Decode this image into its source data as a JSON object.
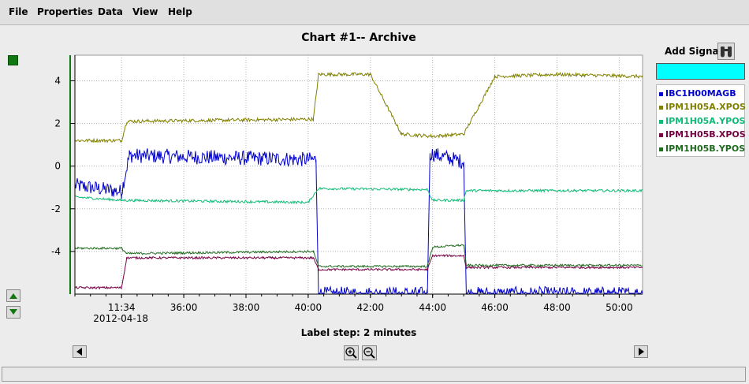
{
  "menu": [
    "File",
    "Properties",
    "Data",
    "View",
    "Help"
  ],
  "chart": {
    "title": "Chart #1-- Archive",
    "label_step": "Label step: 2 minutes"
  },
  "add_signal": {
    "label": "Add Signal",
    "input_value": ""
  },
  "legend": [
    {
      "name": "IBC1H00MAGB",
      "color": "#0000cc"
    },
    {
      "name": "IPM1H05A.XPOS",
      "color": "#808000"
    },
    {
      "name": "IPM1H05A.YPOS",
      "color": "#11bb77"
    },
    {
      "name": "IPM1H05B.XPOS",
      "color": "#770044"
    },
    {
      "name": "IPM1H05B.YPOS",
      "color": "#1f6b1f"
    }
  ],
  "chart_data": {
    "type": "line",
    "title": "Chart #1-- Archive",
    "xlabel": "Label step: 2 minutes",
    "ylabel": "",
    "x_unit": "minutes",
    "xlim": [
      "11:32:30",
      "11:50:45"
    ],
    "ylim": [
      -6.0,
      5.2
    ],
    "grid": true,
    "legend_position": "right",
    "x_ticks": [
      "11:34:00",
      "36:00",
      "38:00",
      "40:00",
      "42:00",
      "44:00",
      "46:00",
      "48:00",
      "50:00"
    ],
    "x_date_label": "2012-04-18",
    "y_ticks": [
      4,
      2,
      0,
      -2,
      -4
    ],
    "series": [
      {
        "name": "IBC1H00MAGB",
        "color": "#0000cc",
        "noise": 0.35,
        "points": [
          [
            "11:32:30",
            -0.9
          ],
          [
            "11:34:00",
            -1.2
          ],
          [
            "11:34:15",
            0.5
          ],
          [
            "11:40:15",
            0.3
          ],
          [
            "11:40:20",
            -6.0
          ],
          [
            "11:43:50",
            -6.0
          ],
          [
            "11:43:55",
            0.6
          ],
          [
            "11:45:00",
            0.2
          ],
          [
            "11:45:05",
            -6.0
          ],
          [
            "11:50:45",
            -6.0
          ]
        ]
      },
      {
        "name": "IPM1H05A.XPOS",
        "color": "#808000",
        "noise": 0.08,
        "points": [
          [
            "11:32:30",
            1.2
          ],
          [
            "11:34:00",
            1.2
          ],
          [
            "11:34:10",
            2.1
          ],
          [
            "11:40:10",
            2.2
          ],
          [
            "11:40:20",
            4.3
          ],
          [
            "11:42:00",
            4.3
          ],
          [
            "11:43:00",
            1.5
          ],
          [
            "11:44:00",
            1.4
          ],
          [
            "11:45:00",
            1.5
          ],
          [
            "11:46:00",
            4.2
          ],
          [
            "11:48:00",
            4.3
          ],
          [
            "11:50:45",
            4.2
          ]
        ]
      },
      {
        "name": "IPM1H05A.YPOS",
        "color": "#11bb77",
        "noise": 0.06,
        "points": [
          [
            "11:32:30",
            -1.45
          ],
          [
            "11:34:00",
            -1.6
          ],
          [
            "11:40:00",
            -1.7
          ],
          [
            "11:40:20",
            -1.05
          ],
          [
            "11:43:50",
            -1.1
          ],
          [
            "11:44:00",
            -1.6
          ],
          [
            "11:45:00",
            -1.6
          ],
          [
            "11:45:05",
            -1.15
          ],
          [
            "11:50:45",
            -1.15
          ]
        ]
      },
      {
        "name": "IPM1H05B.XPOS",
        "color": "#770044",
        "noise": 0.05,
        "points": [
          [
            "11:32:30",
            -5.7
          ],
          [
            "11:34:00",
            -5.7
          ],
          [
            "11:34:10",
            -4.3
          ],
          [
            "11:40:10",
            -4.3
          ],
          [
            "11:40:20",
            -4.85
          ],
          [
            "11:43:50",
            -4.85
          ],
          [
            "11:44:00",
            -4.2
          ],
          [
            "11:45:00",
            -4.2
          ],
          [
            "11:45:05",
            -4.75
          ],
          [
            "11:50:45",
            -4.75
          ]
        ]
      },
      {
        "name": "IPM1H05B.YPOS",
        "color": "#1f6b1f",
        "noise": 0.05,
        "points": [
          [
            "11:32:30",
            -3.85
          ],
          [
            "11:34:00",
            -3.85
          ],
          [
            "11:34:10",
            -4.1
          ],
          [
            "11:40:10",
            -4.0
          ],
          [
            "11:40:20",
            -4.7
          ],
          [
            "11:43:50",
            -4.7
          ],
          [
            "11:44:00",
            -3.8
          ],
          [
            "11:45:00",
            -3.7
          ],
          [
            "11:45:05",
            -4.65
          ],
          [
            "11:50:45",
            -4.65
          ]
        ]
      }
    ]
  }
}
